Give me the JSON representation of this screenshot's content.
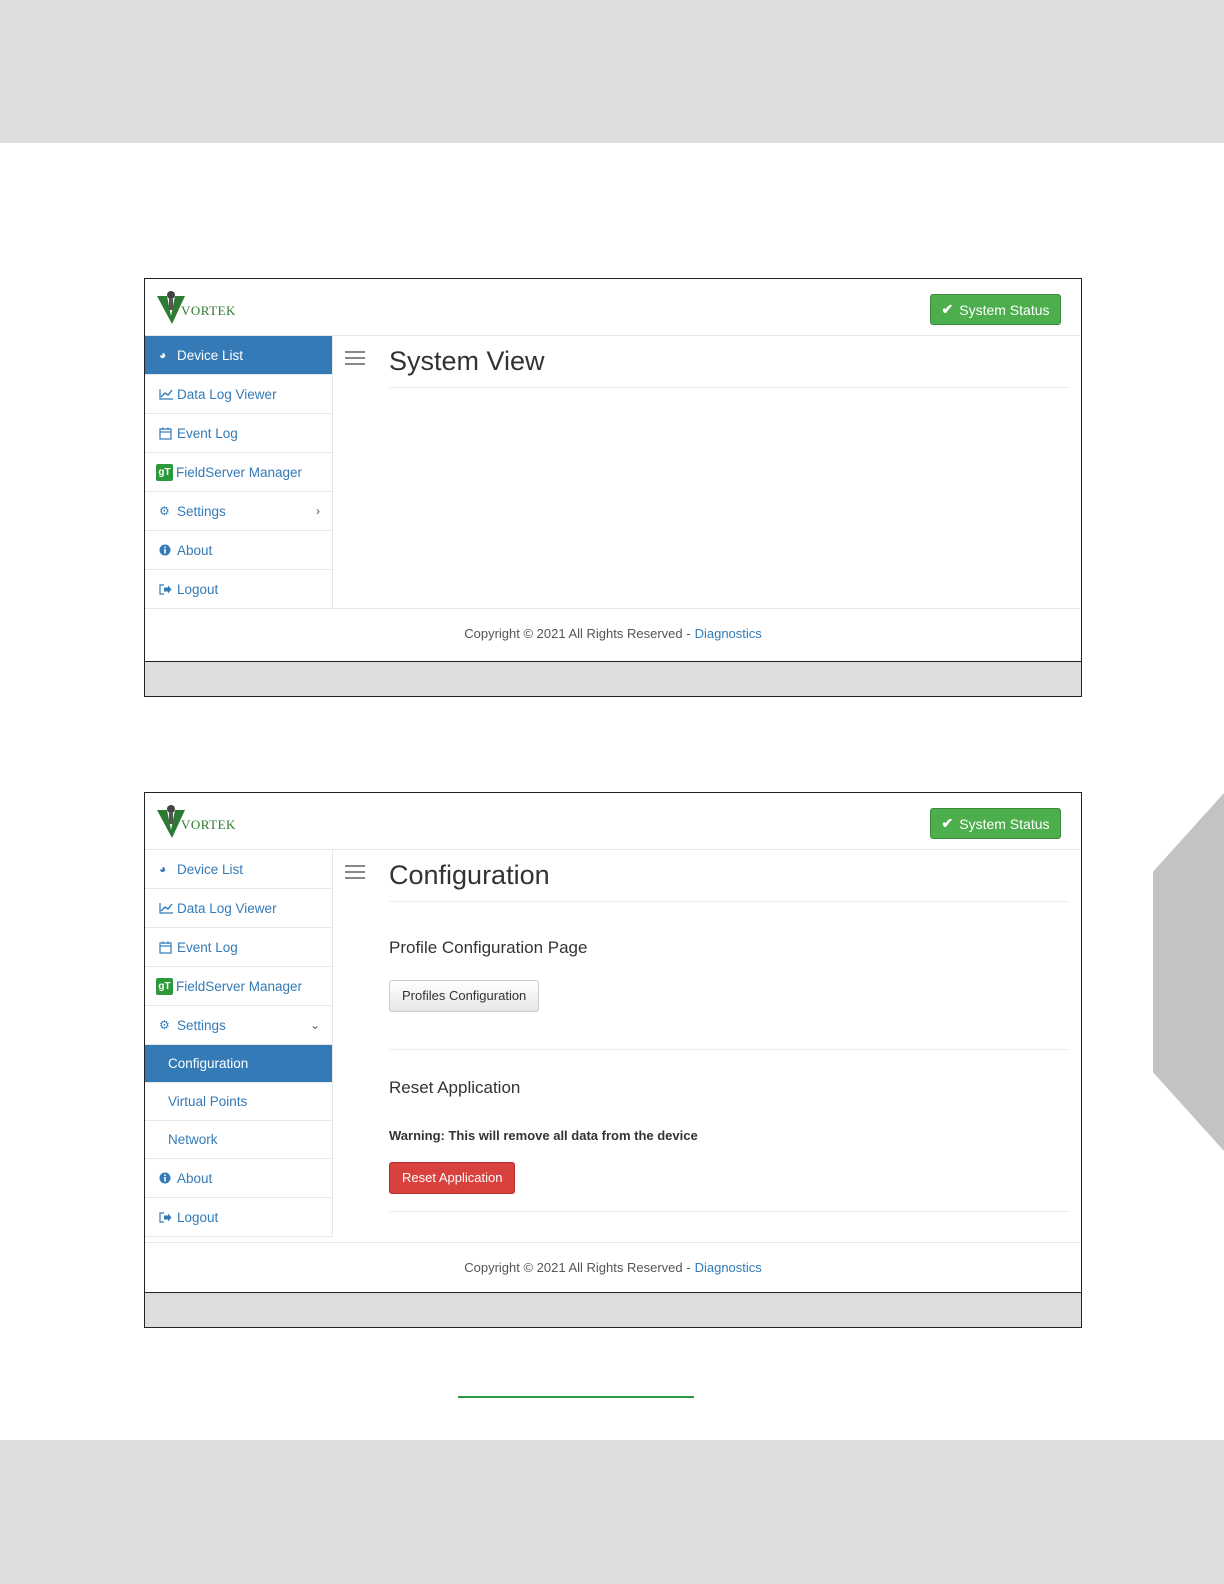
{
  "app": {
    "logo_text": "VORTEK",
    "system_status_label": "System Status",
    "footer_text": "Copyright © 2021 All Rights Reserved -",
    "footer_link": "Diagnostics"
  },
  "screen1": {
    "page_title": "System View",
    "nav": [
      {
        "label": "Device List",
        "icon": "dashboard-icon",
        "active": true
      },
      {
        "label": "Data Log Viewer",
        "icon": "line-chart-icon"
      },
      {
        "label": "Event Log",
        "icon": "calendar-icon"
      },
      {
        "label": "FieldServer Manager",
        "icon": "gt-logo-icon"
      },
      {
        "label": "Settings",
        "icon": "gears-icon",
        "caret": "chevron-right-icon"
      },
      {
        "label": "About",
        "icon": "info-icon"
      },
      {
        "label": "Logout",
        "icon": "sign-out-icon"
      }
    ]
  },
  "screen2": {
    "page_title": "Configuration",
    "nav": [
      {
        "label": "Device List",
        "icon": "dashboard-icon"
      },
      {
        "label": "Data Log Viewer",
        "icon": "line-chart-icon"
      },
      {
        "label": "Event Log",
        "icon": "calendar-icon"
      },
      {
        "label": "FieldServer Manager",
        "icon": "gt-logo-icon"
      },
      {
        "label": "Settings",
        "icon": "gears-icon",
        "caret": "chevron-down-icon"
      },
      {
        "label": "Configuration",
        "sub": true,
        "active": true
      },
      {
        "label": "Virtual Points",
        "sub": true
      },
      {
        "label": "Network",
        "sub": true
      },
      {
        "label": "About",
        "icon": "info-icon"
      },
      {
        "label": "Logout",
        "icon": "sign-out-icon"
      }
    ],
    "profile_section_title": "Profile Configuration Page",
    "profiles_button": "Profiles Configuration",
    "reset_section_title": "Reset Application",
    "warning_text": "Warning: This will remove all data from the device",
    "reset_button": "Reset Application"
  },
  "colors": {
    "primary": "#337ab7",
    "success": "#4cae4c",
    "danger": "#d9413e",
    "brand_green": "#2d9a3a"
  }
}
